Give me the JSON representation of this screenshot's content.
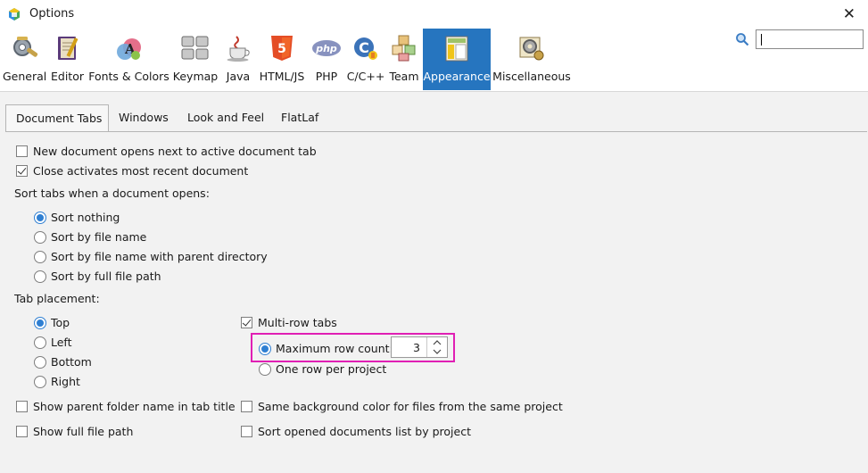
{
  "window": {
    "title": "Options",
    "close_symbol": "✕"
  },
  "toolbar": {
    "categories": [
      {
        "label": "General",
        "icon": "gear-wrench-icon"
      },
      {
        "label": "Editor",
        "icon": "notebook-pen-icon"
      },
      {
        "label": "Fonts & Colors",
        "icon": "palette-icon"
      },
      {
        "label": "Keymap",
        "icon": "keyboard-icon"
      },
      {
        "label": "Java",
        "icon": "java-cup-icon"
      },
      {
        "label": "HTML/JS",
        "icon": "html5-icon"
      },
      {
        "label": "PHP",
        "icon": "php-icon"
      },
      {
        "label": "C/C++",
        "icon": "c-cpp-icon"
      },
      {
        "label": "Team",
        "icon": "team-cubes-icon"
      },
      {
        "label": "Appearance",
        "icon": "appearance-layout-icon",
        "selected": true
      },
      {
        "label": "Miscellaneous",
        "icon": "misc-gears-icon"
      }
    ],
    "search": {
      "value": ""
    }
  },
  "tabs": [
    {
      "label": "Document Tabs",
      "selected": true
    },
    {
      "label": "Windows"
    },
    {
      "label": "Look and Feel"
    },
    {
      "label": "FlatLaf"
    }
  ],
  "options": {
    "new_doc_next": {
      "label": "New document opens next to active document tab",
      "checked": false
    },
    "close_recent": {
      "label": "Close activates most recent document",
      "checked": true
    },
    "sort_heading": "Sort tabs when a document opens:",
    "sort": [
      {
        "label": "Sort nothing",
        "selected": true
      },
      {
        "label": "Sort by file name"
      },
      {
        "label": "Sort by file name with parent directory"
      },
      {
        "label": "Sort by full file path"
      }
    ],
    "placement_heading": "Tab placement:",
    "placement": [
      {
        "label": "Top",
        "selected": true
      },
      {
        "label": "Left"
      },
      {
        "label": "Bottom"
      },
      {
        "label": "Right"
      }
    ],
    "multirow": {
      "label": "Multi-row tabs",
      "checked": true
    },
    "max_rows": {
      "label": "Maximum row count:",
      "selected": true,
      "value": "3"
    },
    "one_row": {
      "label": "One row per project",
      "selected": false
    },
    "parent_folder": {
      "label": "Show parent folder name in tab title",
      "checked": false
    },
    "same_bg": {
      "label": "Same background color for files from the same project",
      "checked": false
    },
    "full_path": {
      "label": "Show full file path",
      "checked": false
    },
    "sort_docs": {
      "label": "Sort opened documents list by project",
      "checked": false
    }
  },
  "colors": {
    "accent": "#2675bf",
    "highlight": "#e01fb4",
    "radio": "#2f7fd2"
  }
}
